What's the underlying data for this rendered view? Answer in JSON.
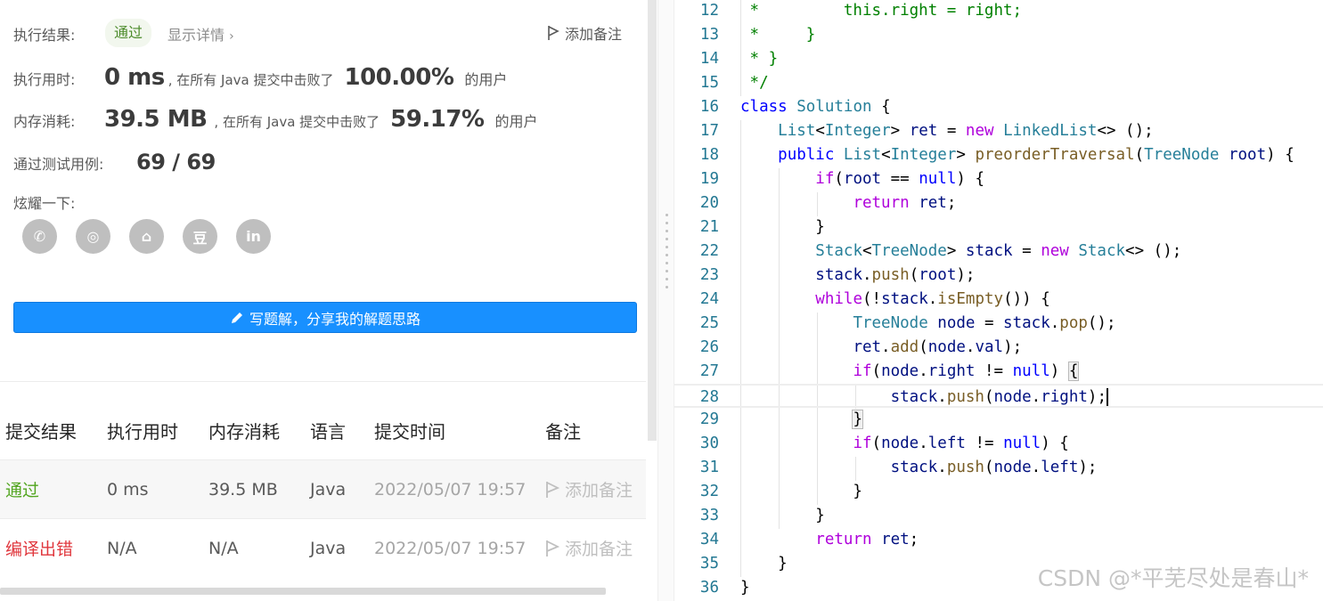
{
  "result": {
    "status_label": "执行结果:",
    "status_value": "通过",
    "detail_link": "显示详情",
    "add_note": "添加备注",
    "runtime_label": "执行用时:",
    "runtime_value": "0 ms",
    "runtime_mid": ", 在所有 Java 提交中击败了",
    "runtime_pct": "100.00%",
    "runtime_tail": "的用户",
    "memory_label": "内存消耗:",
    "memory_value": "39.5 MB",
    "memory_mid": ", 在所有 Java 提交中击败了",
    "memory_pct": "59.17%",
    "memory_tail": "的用户",
    "tests_label": "通过测试用例:",
    "tests_value": "69 / 69",
    "share_label": "炫耀一下:"
  },
  "share_icons": [
    "wechat-icon",
    "weibo-icon",
    "qq-icon",
    "douban-icon",
    "linkedin-icon"
  ],
  "share_glyphs": [
    "✆",
    "◎",
    "⌂",
    "豆",
    "in"
  ],
  "write_button": "写题解，分享我的解题思路",
  "table": {
    "headers": [
      "提交结果",
      "执行用时",
      "内存消耗",
      "语言",
      "提交时间",
      "备注"
    ],
    "rows": [
      {
        "status": "通过",
        "time": "0 ms",
        "memory": "39.5 MB",
        "lang": "Java",
        "submitted": "2022/05/07 19:57",
        "note": "添加备注"
      },
      {
        "status": "编译出错",
        "time": "N/A",
        "memory": "N/A",
        "lang": "Java",
        "submitted": "2022/05/07 19:57",
        "note": "添加备注"
      }
    ]
  },
  "editor": {
    "line_numbers": [
      "12",
      "13",
      "14",
      "15",
      "16",
      "17",
      "18",
      "19",
      "20",
      "21",
      "22",
      "23",
      "24",
      "25",
      "26",
      "27",
      "28",
      "29",
      "30",
      "31",
      "32",
      "33",
      "34",
      "35",
      "36"
    ],
    "current_line": "28"
  },
  "watermark": "CSDN @*平芜尽处是春山*",
  "colors": {
    "accent": "#1890ff",
    "pass": "#52a51f",
    "error": "#e0373d"
  }
}
